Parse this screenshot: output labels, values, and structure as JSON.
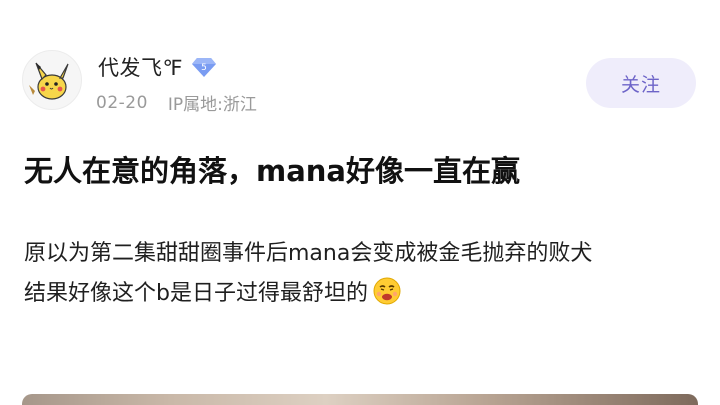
{
  "author": {
    "name": "代发飞℉",
    "level": "5",
    "avatar_icon": "pikachu-avatar",
    "level_icon": "diamond-level-badge-icon"
  },
  "meta": {
    "date": "02-20",
    "ip_location": "IP属地:浙江"
  },
  "actions": {
    "follow_label": "关注"
  },
  "post": {
    "title": "无人在意的角落，mana好像一直在赢",
    "body_lines": [
      "原以为第二集甜甜圈事件后mana会变成被金毛抛弃的败犬",
      "结果好像这个b是日子过得最舒坦的"
    ],
    "emoji": "smirk-emoji"
  },
  "colors": {
    "follow_bg": "#efedfb",
    "follow_text": "#6d64c8",
    "badge_blue": "#7a9cf2",
    "meta_gray": "#9a9a9a"
  }
}
